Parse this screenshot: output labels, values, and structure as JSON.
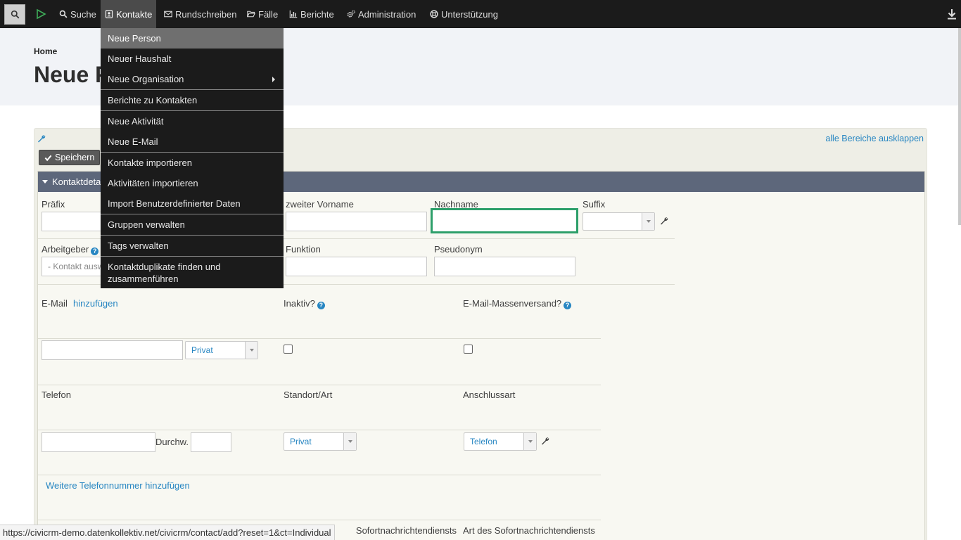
{
  "nav": {
    "items": [
      {
        "label": "Suche",
        "icon": "search-icon"
      },
      {
        "label": "Kontakte",
        "icon": "contact-card-icon"
      },
      {
        "label": "Rundschreiben",
        "icon": "envelope-icon"
      },
      {
        "label": "Fälle",
        "icon": "folder-open-icon"
      },
      {
        "label": "Berichte",
        "icon": "bar-chart-icon"
      },
      {
        "label": "Administration",
        "icon": "gears-icon"
      },
      {
        "label": "Unterstützung",
        "icon": "life-ring-icon"
      }
    ]
  },
  "header": {
    "breadcrumb": "Home",
    "title": "Neue Person"
  },
  "form": {
    "expand_all": "alle Bereiche ausklappen",
    "save_label": "Speichern",
    "section_title": "Kontaktdetails",
    "labels": {
      "prefix": "Präfix",
      "middle_name": "zweiter Vorname",
      "last_name": "Nachname",
      "suffix": "Suffix",
      "employer": "Arbeitgeber",
      "function": "Funktion",
      "nickname": "Pseudonym",
      "email": "E-Mail",
      "email_add": "hinzufügen",
      "inactive": "Inaktiv?",
      "bulk_mail": "E-Mail-Massenversand?",
      "phone": "Telefon",
      "location_type": "Standort/Art",
      "phone_type": "Anschlussart",
      "ext": "Durchw.",
      "add_phone": "Weitere Telefonnummer hinzufügen",
      "im_provider": "Sofortnachrichtendiensts",
      "im_type": "Art des Sofortnachrichtendiensts"
    },
    "employer_placeholder": "- Kontakt auswählen -",
    "email_location": "Privat",
    "phone_location": "Privat",
    "phone_type_value": "Telefon"
  },
  "menu": {
    "items": [
      {
        "label": "Neue Person",
        "hover": true,
        "sep": false,
        "submenu": false
      },
      {
        "label": "Neuer Haushalt",
        "hover": false,
        "sep": false,
        "submenu": false
      },
      {
        "label": "Neue Organisation",
        "hover": false,
        "sep": false,
        "submenu": true
      },
      {
        "label": "Berichte zu Kontakten",
        "hover": false,
        "sep": true,
        "submenu": false
      },
      {
        "label": "Neue Aktivität",
        "hover": false,
        "sep": true,
        "submenu": false
      },
      {
        "label": "Neue E-Mail",
        "hover": false,
        "sep": false,
        "submenu": false
      },
      {
        "label": "Kontakte importieren",
        "hover": false,
        "sep": true,
        "submenu": false
      },
      {
        "label": "Aktivitäten importieren",
        "hover": false,
        "sep": false,
        "submenu": false
      },
      {
        "label": "Import Benutzerdefinierter Daten",
        "hover": false,
        "sep": false,
        "submenu": false
      },
      {
        "label": "Gruppen verwalten",
        "hover": false,
        "sep": true,
        "submenu": false
      },
      {
        "label": "Tags verwalten",
        "hover": false,
        "sep": true,
        "submenu": false
      },
      {
        "label": "Kontaktduplikate finden und zusammenführen",
        "hover": false,
        "sep": true,
        "submenu": false
      }
    ]
  },
  "status_url": "https://civicrm-demo.datenkollektiv.net/civicrm/contact/add?reset=1&ct=Individual",
  "colors": {
    "topbar": "#1b1b1b",
    "accent_link": "#2786c2",
    "section_header": "#5d677b",
    "focus_border": "#2d9f6a"
  }
}
